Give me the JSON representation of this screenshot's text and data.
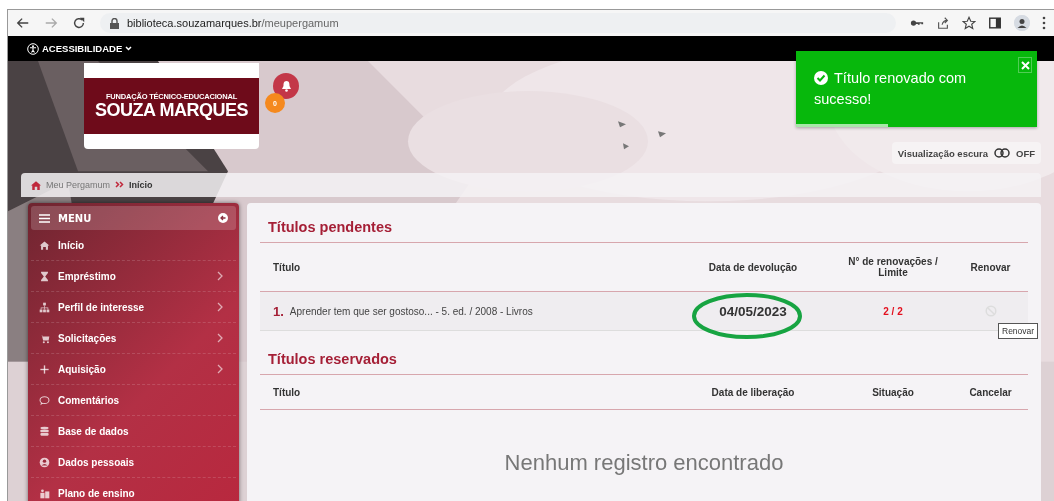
{
  "browser": {
    "url_host": "biblioteca.souzamarques.br",
    "url_path": "/meupergamum"
  },
  "topbar": {
    "accessibility": "ACESSIBILIDADE"
  },
  "logo": {
    "line1": "FUNDAÇÃO TÉCNICO-EDUCACIONAL",
    "line2": "SOUZA MARQUES"
  },
  "notifications": {
    "count": "0"
  },
  "toast": {
    "message": "Título renovado com sucesso!",
    "level": 0.38
  },
  "dark_mode": {
    "label": "Visualização escura",
    "on": false,
    "state": "OFF"
  },
  "breadcrumb": [
    {
      "label": "Meu Pergamum",
      "current": false
    },
    {
      "label": "Início",
      "current": true
    }
  ],
  "menu": {
    "title": "MENU",
    "items": [
      {
        "label": "Início",
        "kind": "home",
        "has_submenu": false
      },
      {
        "label": "Empréstimo",
        "kind": "hourglass",
        "has_submenu": true
      },
      {
        "label": "Perfil de interesse",
        "kind": "sitemap",
        "has_submenu": true
      },
      {
        "label": "Solicitações",
        "kind": "cart",
        "has_submenu": true
      },
      {
        "label": "Aquisição",
        "kind": "plus",
        "has_submenu": true
      },
      {
        "label": "Comentários",
        "kind": "comment",
        "has_submenu": false
      },
      {
        "label": "Base de dados",
        "kind": "database",
        "has_submenu": false
      },
      {
        "label": "Dados pessoais",
        "kind": "user",
        "has_submenu": false
      },
      {
        "label": "Plano de ensino",
        "kind": "teacher",
        "has_submenu": false
      }
    ]
  },
  "pending": {
    "title": "Títulos pendentes",
    "columns": [
      "Título",
      "Data de devolução",
      "N° de renovações / Limite",
      "Renovar"
    ],
    "rows": [
      {
        "number": "1.",
        "title": "Aprender tem que ser gostoso... - 5. ed. / 2008 - Livros",
        "due": "04/05/2023",
        "due_circled": true,
        "renewals": "2 / 2",
        "renew_disabled": true,
        "tooltip": "Renovar"
      }
    ]
  },
  "reserved": {
    "title": "Títulos reservados",
    "columns": [
      "Título",
      "Data de liberação",
      "Situação",
      "Cancelar"
    ],
    "empty": "Nenhum registro encontrado"
  }
}
